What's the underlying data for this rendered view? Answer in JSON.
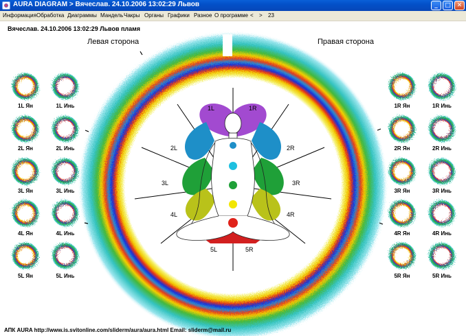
{
  "window": {
    "title": "AURA DIAGRAM > Вячеслав.  24.10.2006 13:02:29 Львов",
    "minimize": "_",
    "maximize": "□",
    "close": "✕"
  },
  "menu": {
    "items": [
      "Информация",
      "Обработка",
      "Диаграммы",
      "Мандель",
      "Чакры",
      "Органы",
      "Графики",
      "Разное",
      "О программе",
      "<",
      ">",
      "23"
    ]
  },
  "header": {
    "text": "Вячеслав. 24.10.2006 13:02:29 Львов пламя"
  },
  "sides": {
    "left_title": "Левая сторона",
    "right_title": "Правая сторона"
  },
  "zones": {
    "labels": [
      "1L",
      "1R",
      "2L",
      "2R",
      "3L",
      "3R",
      "4L",
      "4R",
      "5L",
      "5R"
    ]
  },
  "left_panels": [
    [
      "1L Ян",
      "1L Инь"
    ],
    [
      "2L Ян",
      "2L Инь"
    ],
    [
      "3L Ян",
      "3L Инь"
    ],
    [
      "4L Ян",
      "4L Инь"
    ],
    [
      "5L Ян",
      "5L Инь"
    ]
  ],
  "right_panels": [
    [
      "1R Ян",
      "1R Инь"
    ],
    [
      "2R Ян",
      "2R Инь"
    ],
    [
      "3R Ян",
      "3R Инь"
    ],
    [
      "4R Ян",
      "4R Инь"
    ],
    [
      "5R Ян",
      "5R Инь"
    ]
  ],
  "footer": {
    "text": "АПК AURA      http://www.is.svitonline.com/sliderm/aura/aura.html     Email: sliderm@mail.ru"
  },
  "colors": {
    "titlebar": "#0350c8",
    "aura_outer": "#35c6c6",
    "aura_green": "#2fae3a",
    "aura_yellow": "#f2e600",
    "aura_red": "#e0221a",
    "aura_blue": "#1a2fd8",
    "chakra_crown": "#a24ad0",
    "chakra_throat": "#1e8fc8",
    "chakra_heart": "#1fa038",
    "chakra_solar": "#b9c21a",
    "chakra_root": "#d21f1f"
  }
}
